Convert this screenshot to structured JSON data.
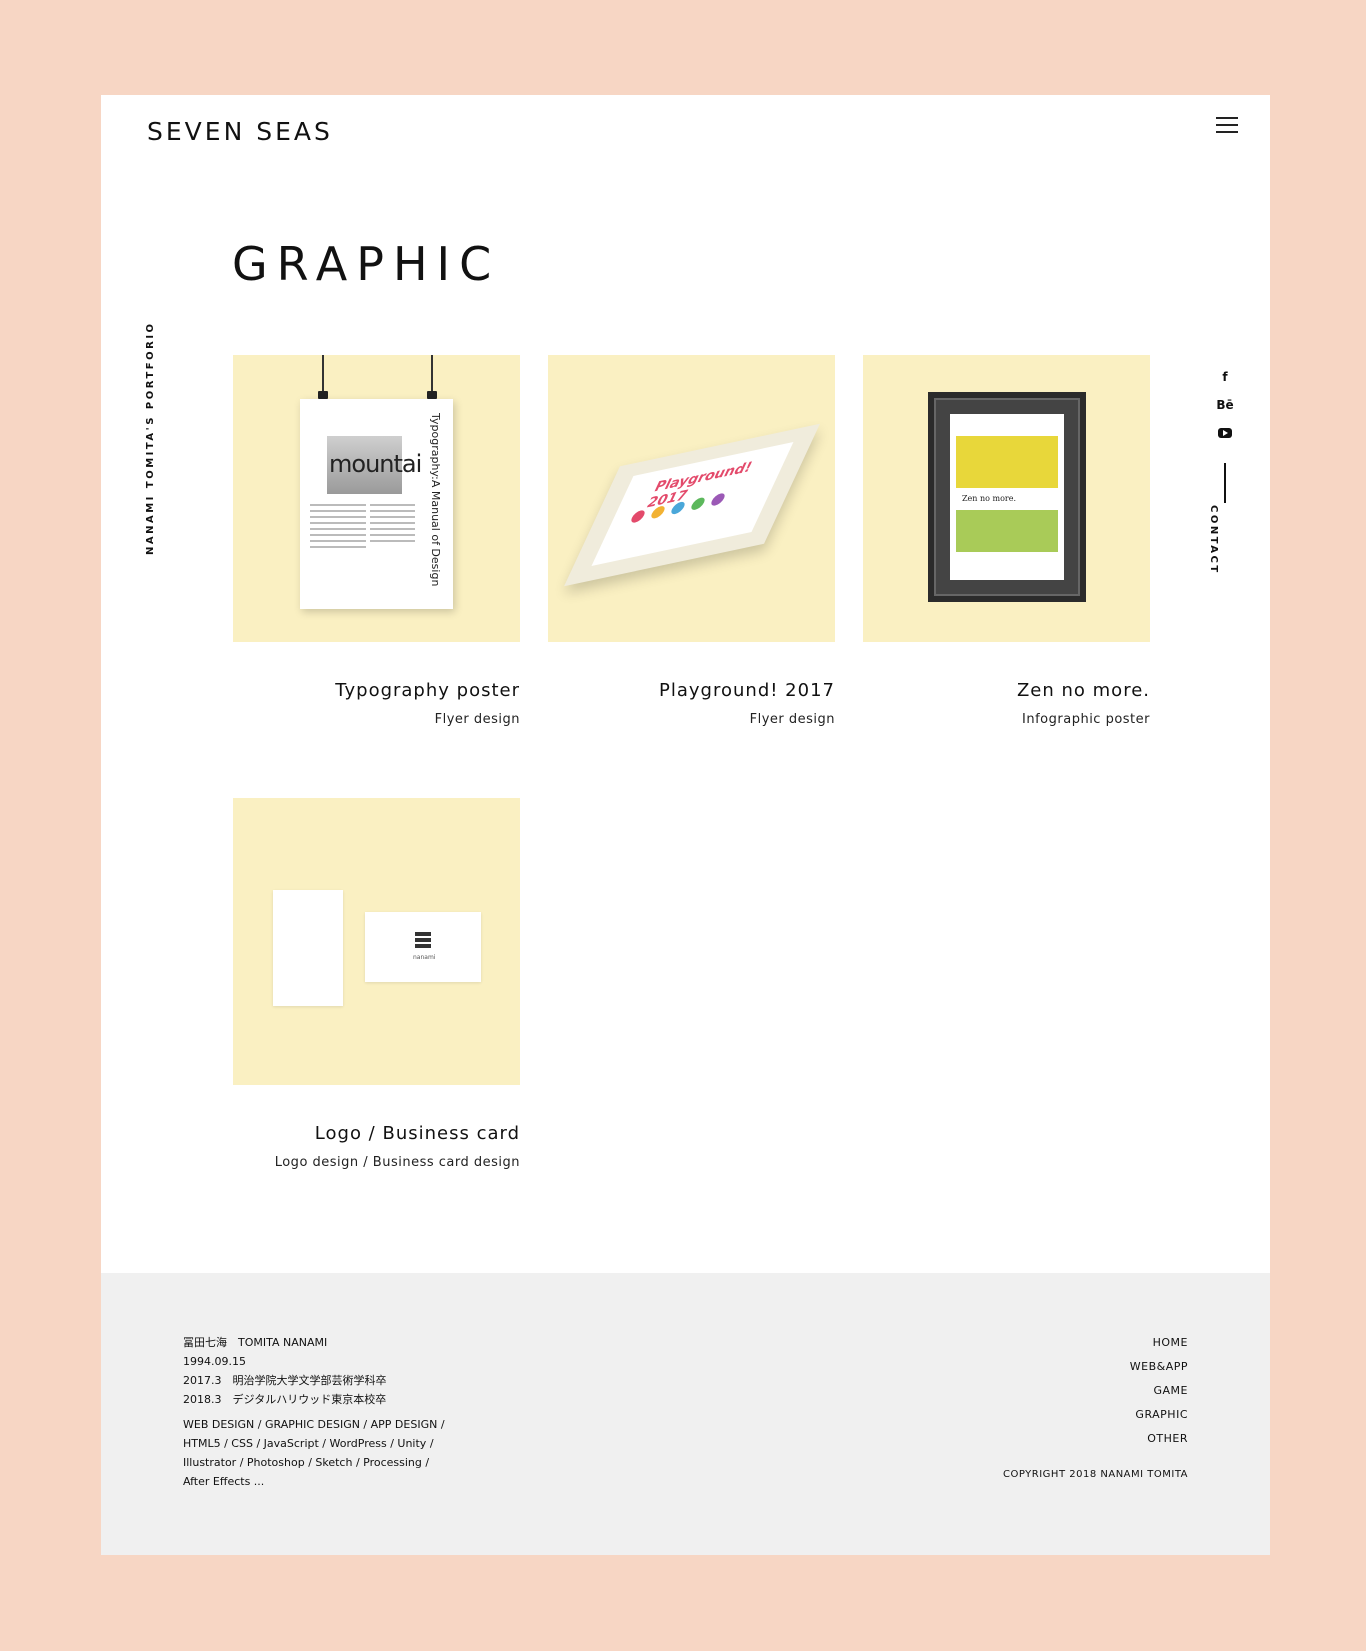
{
  "header": {
    "logo": "SEVEN SEAS"
  },
  "page": {
    "title": "GRAPHIC"
  },
  "side": {
    "left_label": "NANAMI TOMITA'S PORTFORIO",
    "contact": "CONTACT",
    "social": [
      "f",
      "Bē",
      "youtube"
    ]
  },
  "works": [
    {
      "title": "Typography poster",
      "subtitle": "Flyer design",
      "thumb_text": "mountai",
      "thumb_vertical": "Typography:A Manual of Design"
    },
    {
      "title": "Playground! 2017",
      "subtitle": "Flyer design",
      "thumb_text": "Playground! 2017"
    },
    {
      "title": "Zen no more.",
      "subtitle": "Infographic poster",
      "thumb_text": "Zen no more."
    },
    {
      "title": "Logo / Business card",
      "subtitle": "Logo design / Business card design",
      "thumb_text": "nanami"
    }
  ],
  "footer": {
    "name": "冨田七海　TOMITA NANAMI",
    "birth": "1994.09.15",
    "edu1": "2017.3　明治学院大学文学部芸術学科卒",
    "edu2": "2018.3　デジタルハリウッド東京本校卒",
    "skills1": "WEB DESIGN / GRAPHIC DESIGN / APP DESIGN /",
    "skills2": "HTML5 / CSS / JavaScript / WordPress / Unity /",
    "skills3": "Illustrator / Photoshop / Sketch / Processing /",
    "skills4": "After Effects ...",
    "nav": [
      "HOME",
      "WEB&APP",
      "GAME",
      "GRAPHIC",
      "OTHER"
    ],
    "copyright": "COPYRIGHT 2018 NANAMI TOMITA"
  },
  "colors": {
    "outer_bg": "#f7d6c4",
    "thumb_bg": "#faf0c2",
    "footer_bg": "#f0f0f0"
  }
}
